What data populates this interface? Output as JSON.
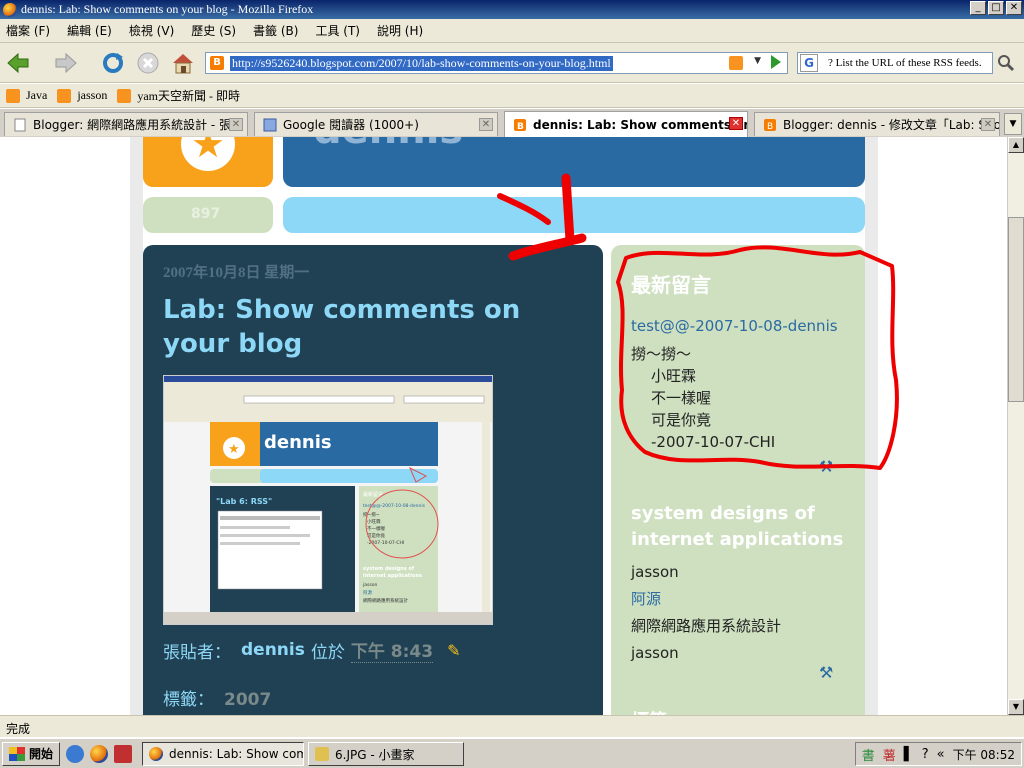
{
  "window": {
    "title": "dennis: Lab: Show comments on your blog - Mozilla Firefox"
  },
  "menu": [
    "檔案 (F)",
    "編輯 (E)",
    "檢視 (V)",
    "歷史 (S)",
    "書籤 (B)",
    "工具 (T)",
    "說明 (H)"
  ],
  "nav": {
    "url": "http://s9526240.blogspot.com/2007/10/lab-show-comments-on-your-blog.html",
    "search_value": "? List the URL of these RSS feeds."
  },
  "bookmarks": [
    "Java",
    "jasson",
    "yam天空新聞 - 即時"
  ],
  "tabs": [
    "Blogger: 網際網路應用系統設計 - 張...",
    "Google 閱讀器 (1000+)",
    "dennis: Lab: Show comments on ...",
    "Blogger: dennis - 修改文章「Lab: Sho..."
  ],
  "blog": {
    "header_title": "dennis",
    "visits": "897",
    "post": {
      "date": "2007年10月8日 星期一",
      "title": "Lab: Show comments on your blog",
      "posted_by_label": "張貼者：",
      "author": "dennis",
      "at_label": "位於",
      "time": "下午 8:43",
      "labels_label": "標籤：",
      "labels_value": "2007"
    },
    "thumbnail": {
      "header": "dennis",
      "post_title": "\"Lab 6: RSS\"",
      "side_title": "最新留言",
      "side_lines": [
        "test@@-2007-10-08-dennis",
        "撈~撈~",
        "小旺霖",
        "不一樣喔",
        "可是你竟",
        "-2007-10-07-CHI",
        "system designs of",
        "internet applications",
        "jasson",
        "阿源",
        "網際網路應用系統設計"
      ]
    },
    "sidebar": {
      "recent_heading": "最新留言",
      "recent_link": "test@@-2007-10-08-dennis",
      "recent_lines": [
        "撈～撈～",
        "小旺霖",
        "不一樣喔",
        "可是你竟",
        "-2007-10-07-CHI"
      ],
      "section_heading": "system designs of internet applications",
      "links": [
        "jasson",
        "阿源",
        "網際網路應用系統設計",
        "jasson"
      ],
      "next_heading": "標籤"
    }
  },
  "status": "完成",
  "taskbar": {
    "start": "開始",
    "windows": [
      "dennis: Lab: Show comme...",
      "6.JPG - 小畫家"
    ],
    "clock": "下午 08:52"
  }
}
